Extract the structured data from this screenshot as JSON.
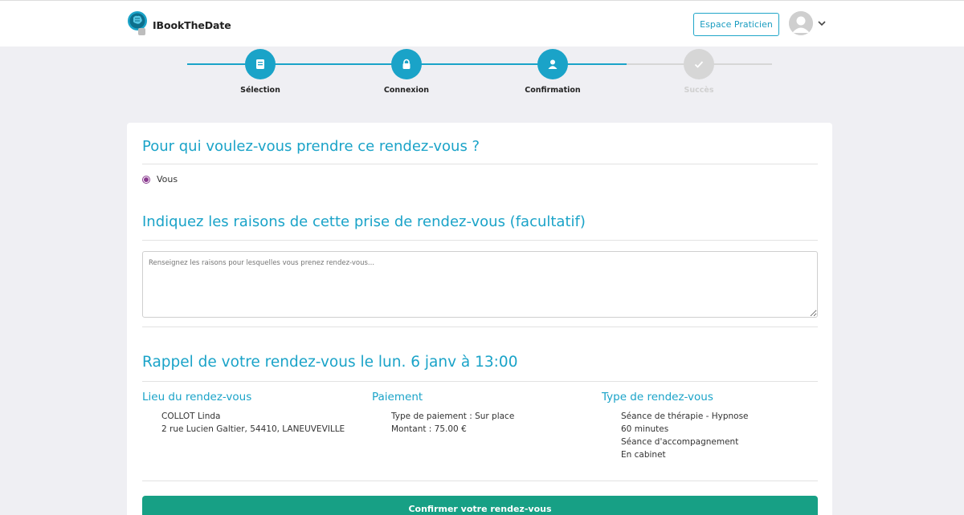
{
  "header": {
    "logo_text": "IBookTheDate",
    "pro_button": "Espace Praticien"
  },
  "stepper": {
    "steps": [
      {
        "label": "Sélection",
        "icon": "book-icon",
        "state": "done"
      },
      {
        "label": "Connexion",
        "icon": "lock-icon",
        "state": "done"
      },
      {
        "label": "Confirmation",
        "icon": "user-icon",
        "state": "current"
      },
      {
        "label": "Succès",
        "icon": "check-icon",
        "state": "pending"
      }
    ]
  },
  "sections": {
    "who_title": "Pour qui voulez-vous prendre ce rendez-vous ?",
    "who_option": "Vous",
    "reasons_title": "Indiquez les raisons de cette prise de rendez-vous (facultatif)",
    "reasons_placeholder": "Renseignez les raisons pour lesquelles vous prenez rendez-vous...",
    "reminder_title": "Rappel de votre rendez-vous le lun. 6 janv à 13:00"
  },
  "details": {
    "location": {
      "title": "Lieu du rendez-vous",
      "lines": [
        "COLLOT Linda",
        "2 rue Lucien Galtier, 54410, LANEUVEVILLE"
      ]
    },
    "payment": {
      "title": "Paiement",
      "lines": [
        "Type de paiement : Sur place",
        "Montant : 75.00 €"
      ]
    },
    "type": {
      "title": "Type de rendez-vous",
      "lines": [
        "Séance de thérapie - Hypnose",
        "60 minutes",
        "Séance d'accompagnement",
        "En cabinet"
      ]
    }
  },
  "confirm_button": "Confirmer votre rendez-vous",
  "colors": {
    "accent": "#1aa3c8",
    "confirm": "#17a085",
    "radio": "#8a3b8f",
    "pending": "#d6d6d6"
  }
}
